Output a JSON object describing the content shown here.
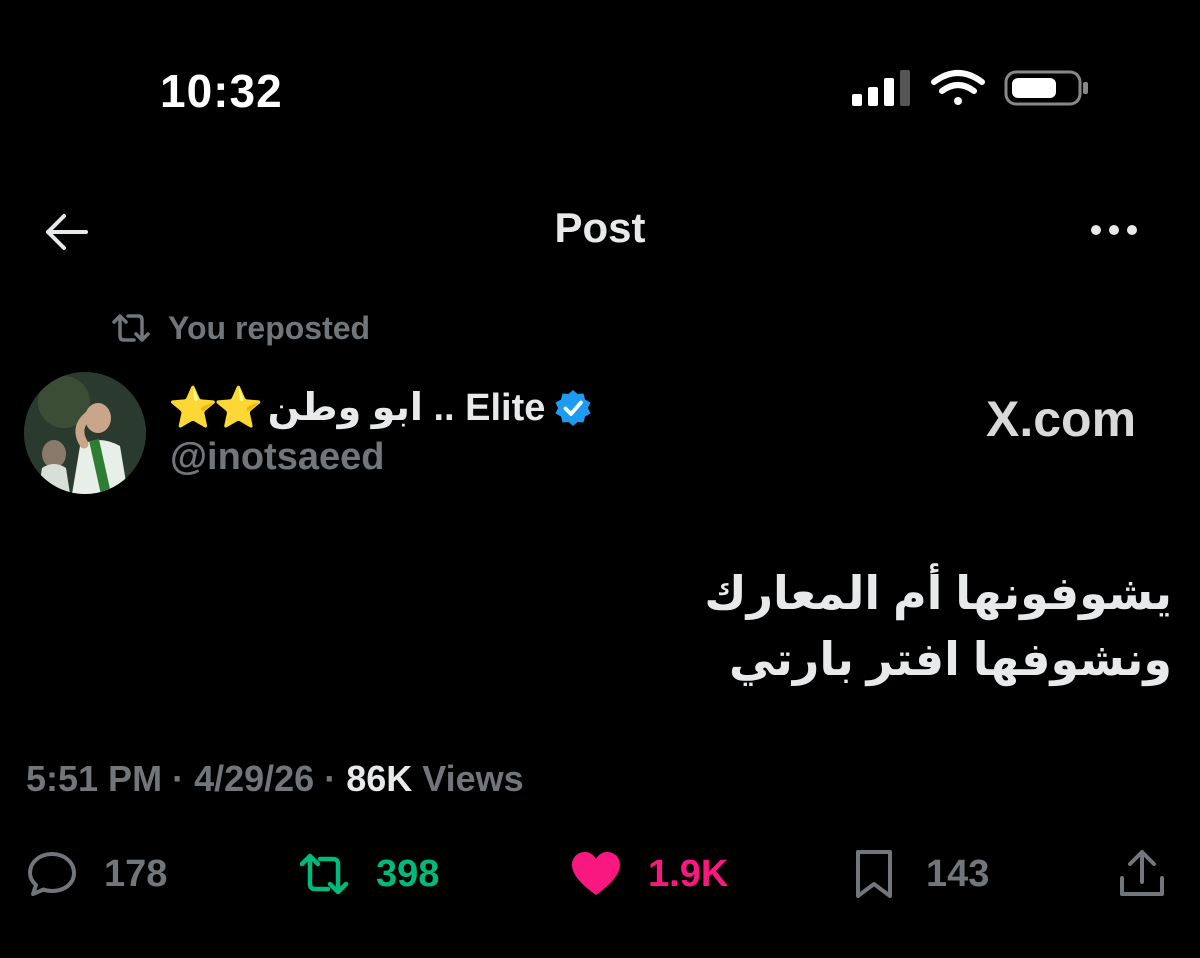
{
  "status_bar": {
    "time": "10:32"
  },
  "header": {
    "title": "Post"
  },
  "repost_context": {
    "label": "You reposted"
  },
  "author": {
    "stars": "⭐⭐",
    "name": "ابو وطن .. Elite",
    "handle": "@inotsaeed",
    "verified": true
  },
  "watermark": "X.com",
  "tweet": {
    "lines": [
      "يشوفونها أم المعارك",
      "ونشوفها افتر بارتي"
    ],
    "time": "5:51 PM",
    "date": "4/29/26",
    "views_count": "86K",
    "views_label": "Views"
  },
  "actions": {
    "replies": "178",
    "reposts": "398",
    "likes": "1.9K",
    "bookmarks": "143"
  },
  "colors": {
    "background": "#000000",
    "text_primary": "#e7e9ea",
    "text_secondary": "#71767b",
    "retweet_active": "#00ba7c",
    "like_active": "#f91880",
    "verified_blue": "#1d9bf0",
    "star_gold": "#f6c338"
  },
  "icons": [
    "signal-icon",
    "wifi-icon",
    "battery-icon",
    "back-arrow-icon",
    "more-icon",
    "repost-icon",
    "verified-badge-icon",
    "reply-icon",
    "retweet-icon",
    "heart-icon",
    "bookmark-icon",
    "share-icon"
  ]
}
